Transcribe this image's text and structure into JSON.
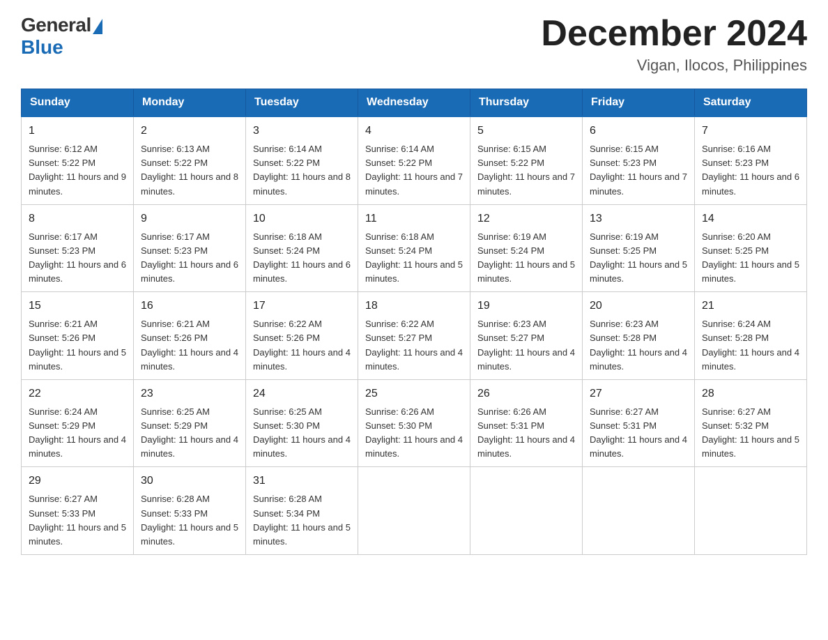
{
  "header": {
    "logo": {
      "general": "General",
      "blue": "Blue"
    },
    "title": "December 2024",
    "location": "Vigan, Ilocos, Philippines"
  },
  "calendar": {
    "days_of_week": [
      "Sunday",
      "Monday",
      "Tuesday",
      "Wednesday",
      "Thursday",
      "Friday",
      "Saturday"
    ],
    "weeks": [
      [
        {
          "day": "1",
          "sunrise": "6:12 AM",
          "sunset": "5:22 PM",
          "daylight": "11 hours and 9 minutes."
        },
        {
          "day": "2",
          "sunrise": "6:13 AM",
          "sunset": "5:22 PM",
          "daylight": "11 hours and 8 minutes."
        },
        {
          "day": "3",
          "sunrise": "6:14 AM",
          "sunset": "5:22 PM",
          "daylight": "11 hours and 8 minutes."
        },
        {
          "day": "4",
          "sunrise": "6:14 AM",
          "sunset": "5:22 PM",
          "daylight": "11 hours and 7 minutes."
        },
        {
          "day": "5",
          "sunrise": "6:15 AM",
          "sunset": "5:22 PM",
          "daylight": "11 hours and 7 minutes."
        },
        {
          "day": "6",
          "sunrise": "6:15 AM",
          "sunset": "5:23 PM",
          "daylight": "11 hours and 7 minutes."
        },
        {
          "day": "7",
          "sunrise": "6:16 AM",
          "sunset": "5:23 PM",
          "daylight": "11 hours and 6 minutes."
        }
      ],
      [
        {
          "day": "8",
          "sunrise": "6:17 AM",
          "sunset": "5:23 PM",
          "daylight": "11 hours and 6 minutes."
        },
        {
          "day": "9",
          "sunrise": "6:17 AM",
          "sunset": "5:23 PM",
          "daylight": "11 hours and 6 minutes."
        },
        {
          "day": "10",
          "sunrise": "6:18 AM",
          "sunset": "5:24 PM",
          "daylight": "11 hours and 6 minutes."
        },
        {
          "day": "11",
          "sunrise": "6:18 AM",
          "sunset": "5:24 PM",
          "daylight": "11 hours and 5 minutes."
        },
        {
          "day": "12",
          "sunrise": "6:19 AM",
          "sunset": "5:24 PM",
          "daylight": "11 hours and 5 minutes."
        },
        {
          "day": "13",
          "sunrise": "6:19 AM",
          "sunset": "5:25 PM",
          "daylight": "11 hours and 5 minutes."
        },
        {
          "day": "14",
          "sunrise": "6:20 AM",
          "sunset": "5:25 PM",
          "daylight": "11 hours and 5 minutes."
        }
      ],
      [
        {
          "day": "15",
          "sunrise": "6:21 AM",
          "sunset": "5:26 PM",
          "daylight": "11 hours and 5 minutes."
        },
        {
          "day": "16",
          "sunrise": "6:21 AM",
          "sunset": "5:26 PM",
          "daylight": "11 hours and 4 minutes."
        },
        {
          "day": "17",
          "sunrise": "6:22 AM",
          "sunset": "5:26 PM",
          "daylight": "11 hours and 4 minutes."
        },
        {
          "day": "18",
          "sunrise": "6:22 AM",
          "sunset": "5:27 PM",
          "daylight": "11 hours and 4 minutes."
        },
        {
          "day": "19",
          "sunrise": "6:23 AM",
          "sunset": "5:27 PM",
          "daylight": "11 hours and 4 minutes."
        },
        {
          "day": "20",
          "sunrise": "6:23 AM",
          "sunset": "5:28 PM",
          "daylight": "11 hours and 4 minutes."
        },
        {
          "day": "21",
          "sunrise": "6:24 AM",
          "sunset": "5:28 PM",
          "daylight": "11 hours and 4 minutes."
        }
      ],
      [
        {
          "day": "22",
          "sunrise": "6:24 AM",
          "sunset": "5:29 PM",
          "daylight": "11 hours and 4 minutes."
        },
        {
          "day": "23",
          "sunrise": "6:25 AM",
          "sunset": "5:29 PM",
          "daylight": "11 hours and 4 minutes."
        },
        {
          "day": "24",
          "sunrise": "6:25 AM",
          "sunset": "5:30 PM",
          "daylight": "11 hours and 4 minutes."
        },
        {
          "day": "25",
          "sunrise": "6:26 AM",
          "sunset": "5:30 PM",
          "daylight": "11 hours and 4 minutes."
        },
        {
          "day": "26",
          "sunrise": "6:26 AM",
          "sunset": "5:31 PM",
          "daylight": "11 hours and 4 minutes."
        },
        {
          "day": "27",
          "sunrise": "6:27 AM",
          "sunset": "5:31 PM",
          "daylight": "11 hours and 4 minutes."
        },
        {
          "day": "28",
          "sunrise": "6:27 AM",
          "sunset": "5:32 PM",
          "daylight": "11 hours and 5 minutes."
        }
      ],
      [
        {
          "day": "29",
          "sunrise": "6:27 AM",
          "sunset": "5:33 PM",
          "daylight": "11 hours and 5 minutes."
        },
        {
          "day": "30",
          "sunrise": "6:28 AM",
          "sunset": "5:33 PM",
          "daylight": "11 hours and 5 minutes."
        },
        {
          "day": "31",
          "sunrise": "6:28 AM",
          "sunset": "5:34 PM",
          "daylight": "11 hours and 5 minutes."
        },
        null,
        null,
        null,
        null
      ]
    ]
  }
}
